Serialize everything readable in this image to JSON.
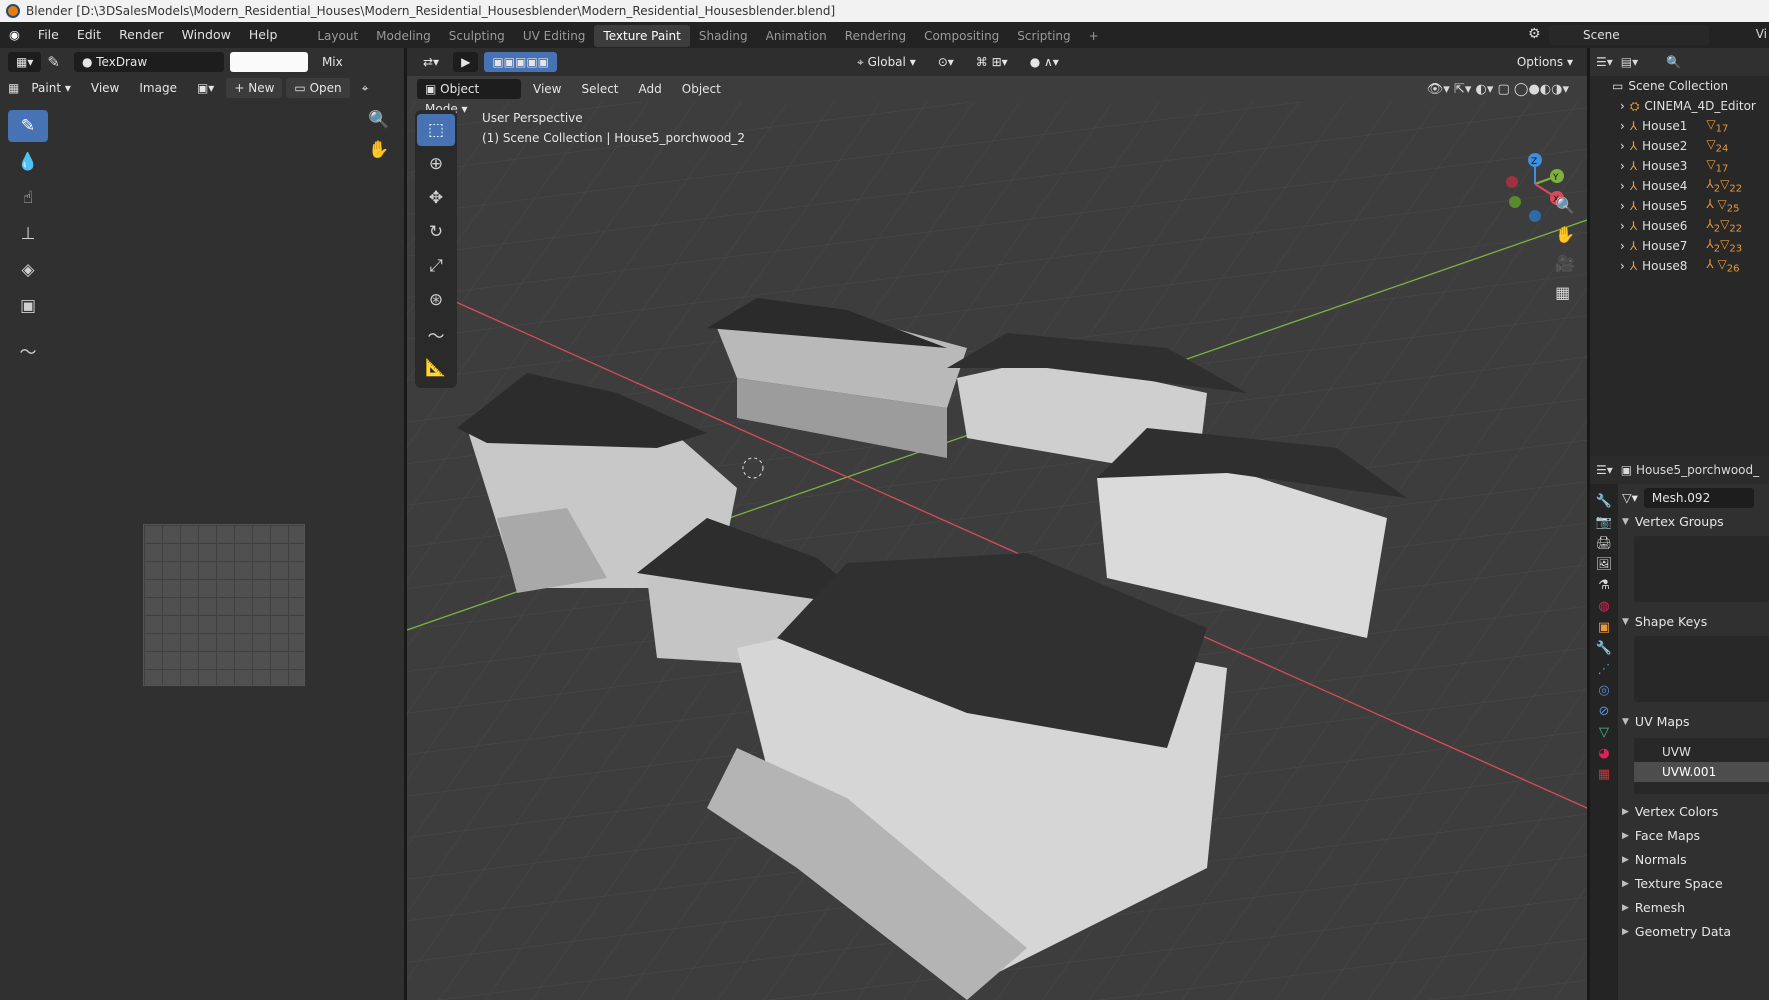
{
  "window": {
    "title": "Blender [D:\\3DSalesModels\\Modern_Residential_Houses\\Modern_Residential_Housesblender\\Modern_Residential_Housesblender.blend]"
  },
  "menu": [
    "File",
    "Edit",
    "Render",
    "Window",
    "Help"
  ],
  "workspaces": [
    "Layout",
    "Modeling",
    "Sculpting",
    "UV Editing",
    "Texture Paint",
    "Shading",
    "Animation",
    "Rendering",
    "Compositing",
    "Scripting"
  ],
  "active_workspace": "Texture Paint",
  "scene_name": "Scene",
  "view_layer_short": "Vi",
  "paint_header": {
    "brush": "TexDraw",
    "blend": "Mix"
  },
  "image_editor": {
    "mode": "Paint",
    "view": "View",
    "image": "Image",
    "new": "New",
    "open": "Open"
  },
  "viewport": {
    "orientation": "Global",
    "options": "Options",
    "mode": "Object Mode",
    "view": "View",
    "select": "Select",
    "add": "Add",
    "object": "Object",
    "info_line1": "User Perspective",
    "info_line2": "(1) Scene Collection | House5_porchwood_2",
    "gizmo": {
      "x": "X",
      "y": "Y",
      "z": "Z"
    }
  },
  "outliner": {
    "root": "Scene Collection",
    "items": [
      {
        "name": "CINEMA_4D_Editor",
        "badge": ""
      },
      {
        "name": "House1",
        "badge": "17"
      },
      {
        "name": "House2",
        "badge": "24"
      },
      {
        "name": "House3",
        "badge": "17"
      },
      {
        "name": "House4",
        "badge": "22"
      },
      {
        "name": "House5",
        "badge": "25"
      },
      {
        "name": "House6",
        "badge": "22"
      },
      {
        "name": "House7",
        "badge": "23"
      },
      {
        "name": "House8",
        "badge": "26"
      }
    ],
    "badge_small": "2"
  },
  "properties": {
    "object": "House5_porchwood_",
    "mesh": "Mesh.092",
    "sections_open": [
      "Vertex Groups",
      "Shape Keys",
      "UV Maps"
    ],
    "uv_maps": [
      "UVW",
      "UVW.001"
    ],
    "sections_closed": [
      "Vertex Colors",
      "Face Maps",
      "Normals",
      "Texture Space",
      "Remesh",
      "Geometry Data"
    ]
  },
  "colors": {
    "accent": "#4772b3",
    "selected_uv": "#4d4d4d",
    "x_axis": "#d94b5b",
    "y_axis": "#7fb13f",
    "z_axis": "#3f8ee0"
  }
}
